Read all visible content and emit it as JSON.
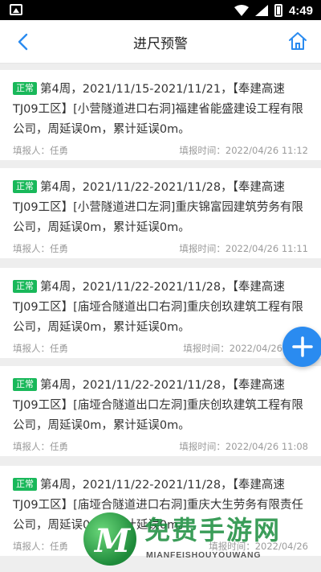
{
  "status_bar": {
    "time": "4:49"
  },
  "header": {
    "title": "进尺预警",
    "back_icon": "back-arrow-icon",
    "home_icon": "home-icon"
  },
  "colors": {
    "accent": "#2a8bf0",
    "tag": "#19b85a",
    "muted": "#9b9b9b"
  },
  "items": [
    {
      "tag": "正常",
      "text": "第4周，2021/11/15-2021/11/21，【奉建高速TJ09工区】[小营隧道进口右洞]福建省能盛建设工程有限公司，周延误0m，累计延误0m。",
      "reporter": "填报人：任勇",
      "time": "填报时间：2022/04/26 11:12"
    },
    {
      "tag": "正常",
      "text": "第4周，2021/11/22-2021/11/28，【奉建高速TJ09工区】[小营隧道进口左洞]重庆锦富园建筑劳务有限公司，周延误0m，累计延误0m。",
      "reporter": "填报人：任勇",
      "time": "填报时间：2022/04/26 11:11"
    },
    {
      "tag": "正常",
      "text": "第4周，2021/11/22-2021/11/28，【奉建高速TJ09工区】[庙垭合隧道出口右洞]重庆创玖建筑工程有限公司，周延误0m，累计延误0m。",
      "reporter": "填报人：任勇",
      "time": "填报时间：2022/04/26"
    },
    {
      "tag": "正常",
      "text": "第4周，2021/11/22-2021/11/28，【奉建高速TJ09工区】[庙垭合隧道出口左洞]重庆创玖建筑工程有限公司，周延误0m，累计延误0m。",
      "reporter": "填报人：任勇",
      "time": "填报时间：2022/04/26 11:08"
    },
    {
      "tag": "正常",
      "text": "第4周，2021/11/22-2021/11/28，【奉建高速TJ09工区】[庙垭合隧道进口右洞]重庆大生劳务有限责任公司，周延误0m，累计延误0m。",
      "reporter": "填报人：任勇",
      "time": "填报时间：2022/04/26"
    }
  ],
  "fab": {
    "icon": "plus-icon"
  },
  "watermark": {
    "title": "免费手游网",
    "subtitle": "MIANFEISHOUYOUWANG",
    "logo_letter": "M"
  }
}
